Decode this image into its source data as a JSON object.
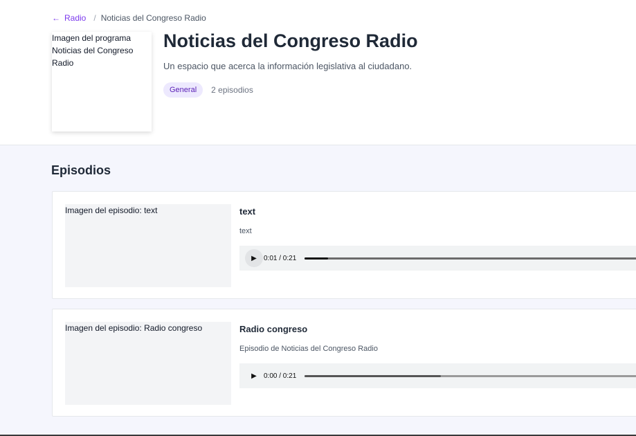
{
  "breadcrumb": {
    "back_arrow": "←",
    "back_label": "Radio",
    "separator": "/",
    "current": "Noticias del Congreso Radio"
  },
  "program": {
    "cover_alt": "Imagen del programa Noticias del Congreso Radio",
    "title": "Noticias del Congreso Radio",
    "description": "Un espacio que acerca la información legislativa al ciudadano.",
    "category": "General",
    "episode_count": "2 episodios"
  },
  "episodes_section": {
    "title": "Episodios",
    "items": [
      {
        "thumb_alt": "Imagen del episodio: text",
        "title": "text",
        "description": "text",
        "player": {
          "play_icon": "▶",
          "time": "0:01 / 0:21",
          "progress": 0.07
        }
      },
      {
        "thumb_alt": "Imagen del episodio: Radio congreso",
        "title": "Radio congreso",
        "description": "Episodio de Noticias del Congreso Radio",
        "player": {
          "play_icon": "▶",
          "time": "0:00 / 0:21",
          "buffered": 0.41
        }
      }
    ]
  },
  "colors": {
    "accent": "#7c3aed",
    "badge_bg": "#ede9fe",
    "section_bg": "#f5f6fd"
  }
}
